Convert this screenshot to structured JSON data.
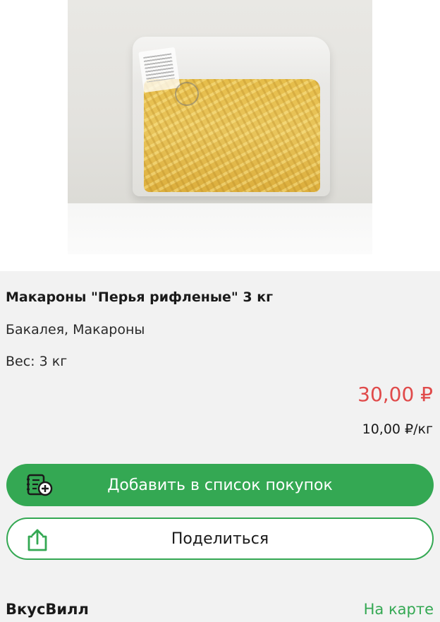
{
  "product": {
    "title": "Макароны \"Перья рифленые\" 3 кг",
    "category": "Бакалея, Макароны",
    "weight": "Вес: 3 кг",
    "price": "30,00 ₽",
    "unit_price": "10,00 ₽/кг",
    "image_icon": "pasta-bag-photo"
  },
  "actions": {
    "add_label": "Добавить в список покупок",
    "add_icon": "add-to-list-icon",
    "share_label": "Поделиться",
    "share_icon": "share-icon"
  },
  "store": {
    "name": "ВкусВилл",
    "map_link": "На карте"
  },
  "colors": {
    "accent_green": "#34a853",
    "price_red": "#e04a4a",
    "background": "#f2f2f2"
  }
}
